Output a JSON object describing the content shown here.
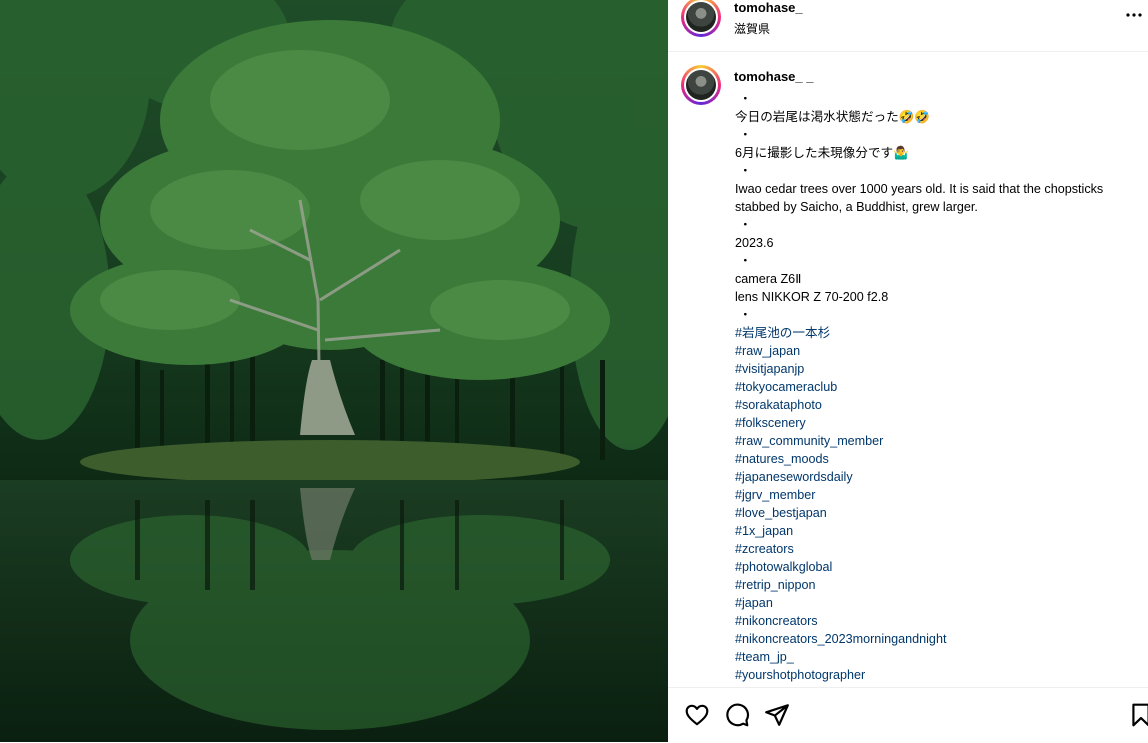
{
  "header": {
    "username": "tomohase_",
    "location": "滋賀県",
    "more_icon": "more-horizontal-icon"
  },
  "caption": {
    "username": "tomohase_ _",
    "lines": [
      "・",
      "今日の岩尾は渇水状態だった🤣🤣",
      "・",
      "6月に撮影した未現像分です🤷‍♂️",
      "・",
      "Iwao cedar trees over 1000 years old. It is said that the chopsticks stabbed by Saicho, a Buddhist, grew larger.",
      "・",
      "2023.6",
      "・",
      "camera Z6Ⅱ",
      "lens NIKKOR Z 70-200 f2.8",
      "・"
    ],
    "hashtags": [
      "#岩尾池の一本杉",
      "#raw_japan",
      "#visitjapanjp",
      "#tokyocameraclub",
      "#sorakataphoto",
      "#folkscenery",
      "#raw_community_member",
      "#natures_moods",
      "#japanesewordsdaily",
      "#jgrv_member",
      "#love_bestjapan",
      "#1x_japan",
      "#zcreators",
      "#photowalkglobal",
      "#retrip_nippon",
      "#japan",
      "#nikoncreators",
      "#nikoncreators_2023morningandnight",
      "#team_jp_",
      "#yourshotphotographer"
    ]
  },
  "actions": {
    "icons": [
      "heart-icon",
      "comment-icon",
      "share-icon",
      "bookmark-icon"
    ]
  },
  "colors": {
    "hashtag": "#00376b",
    "forest_dark": "#0d2a16",
    "forest_mid": "#2f6b32",
    "trunk": "#8f9a86"
  }
}
